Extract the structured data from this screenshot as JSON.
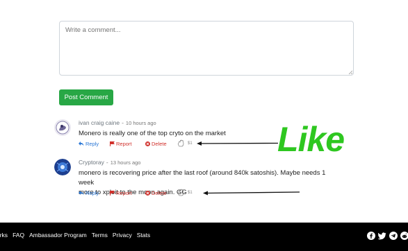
{
  "comment_form": {
    "placeholder": "Write a comment...",
    "submit_label": "Post Comment"
  },
  "comments": [
    {
      "author": "ivan craig caine",
      "separator": "-",
      "time": "10 hours ago",
      "text": "Monero is really one of the top cryto on the market",
      "reply_label": "Reply",
      "report_label": "Report",
      "delete_label": "Delete",
      "like_count": "$1"
    },
    {
      "author": "Cryptoray",
      "separator": "-",
      "time": "13 hours ago",
      "text_line1": "monero is recovering price after the last roof (around 840k satoshis). Maybe needs 1 week",
      "text_line2": "more to xploit to the moon again. GG",
      "reply_label": "Reply",
      "report_label": "Report",
      "delete_label": "Delete",
      "like_count": "$1"
    }
  ],
  "annotation": {
    "label": "Like",
    "color": "#2ec720"
  },
  "footer": {
    "links": [
      "orks",
      "FAQ",
      "Ambassador Program",
      "Terms",
      "Privacy",
      "Stats"
    ],
    "social_icons": [
      "facebook-icon",
      "twitter-icon",
      "telegram-icon",
      "reddit-icon"
    ]
  },
  "colors": {
    "post_button": "#28a745",
    "reply": "#2b78d6",
    "report": "#d0302b",
    "footer_bg": "#000000"
  }
}
